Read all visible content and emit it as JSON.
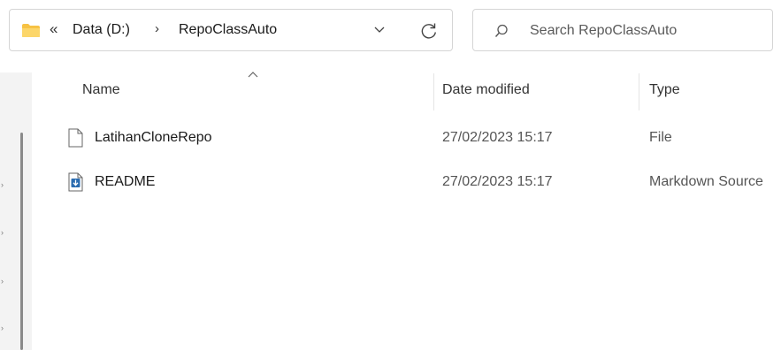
{
  "address_bar": {
    "overflow_chevron": "«",
    "breadcrumbs": [
      {
        "label": "Data (D:)"
      },
      {
        "label": "RepoClassAuto"
      }
    ],
    "separator": "›",
    "folder_icon": "folder-icon",
    "dropdown_icon": "chevron-down-icon",
    "refresh_icon": "refresh-icon"
  },
  "search": {
    "placeholder": "Search RepoClassAuto",
    "value": "",
    "icon": "search-icon"
  },
  "columns": {
    "name": "Name",
    "date_modified": "Date modified",
    "type": "Type",
    "sort_indicator": "chevron-up-icon"
  },
  "files": [
    {
      "name": "LatihanCloneRepo",
      "date_modified": "27/02/2023 15:17",
      "type": "File",
      "icon": "file-icon"
    },
    {
      "name": "README",
      "date_modified": "27/02/2023 15:17",
      "type": "Markdown Source",
      "icon": "markdown-file-icon"
    }
  ],
  "nav_pane": {
    "expander_glyph": "›"
  },
  "colors": {
    "folder_yellow": "#f7c244",
    "markdown_blue": "#2b6cb0",
    "border": "#d5d5d5",
    "nav_pane_bg": "#f3f3f3"
  }
}
